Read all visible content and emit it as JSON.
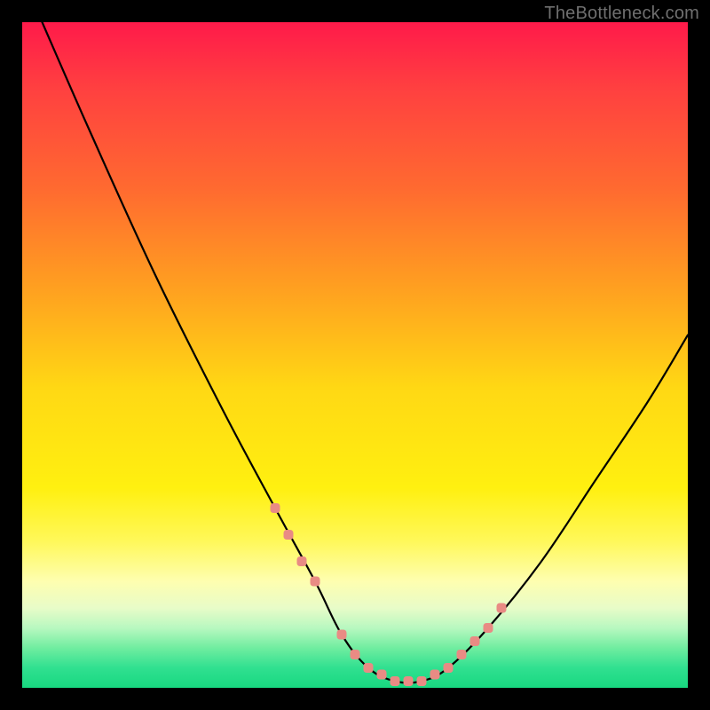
{
  "watermark": "TheBottleneck.com",
  "chart_data": {
    "type": "line",
    "title": "",
    "xlabel": "",
    "ylabel": "",
    "xlim": [
      0,
      100
    ],
    "ylim": [
      0,
      100
    ],
    "series": [
      {
        "name": "bottleneck-curve",
        "x": [
          3,
          10,
          20,
          30,
          38,
          44,
          48,
          52,
          56,
          60,
          64,
          70,
          78,
          86,
          94,
          100
        ],
        "values": [
          100,
          84,
          62,
          42,
          27,
          16,
          8,
          3,
          1,
          1,
          3,
          9,
          19,
          31,
          43,
          53
        ]
      }
    ],
    "markers": {
      "name": "highlight-dots",
      "color": "#e98b84",
      "x": [
        38,
        40,
        42,
        44,
        48,
        50,
        52,
        54,
        56,
        58,
        60,
        62,
        64,
        66,
        68,
        70,
        72
      ],
      "values": [
        27,
        23,
        19,
        16,
        8,
        5,
        3,
        2,
        1,
        1,
        1,
        2,
        3,
        5,
        7,
        9,
        12
      ]
    }
  }
}
